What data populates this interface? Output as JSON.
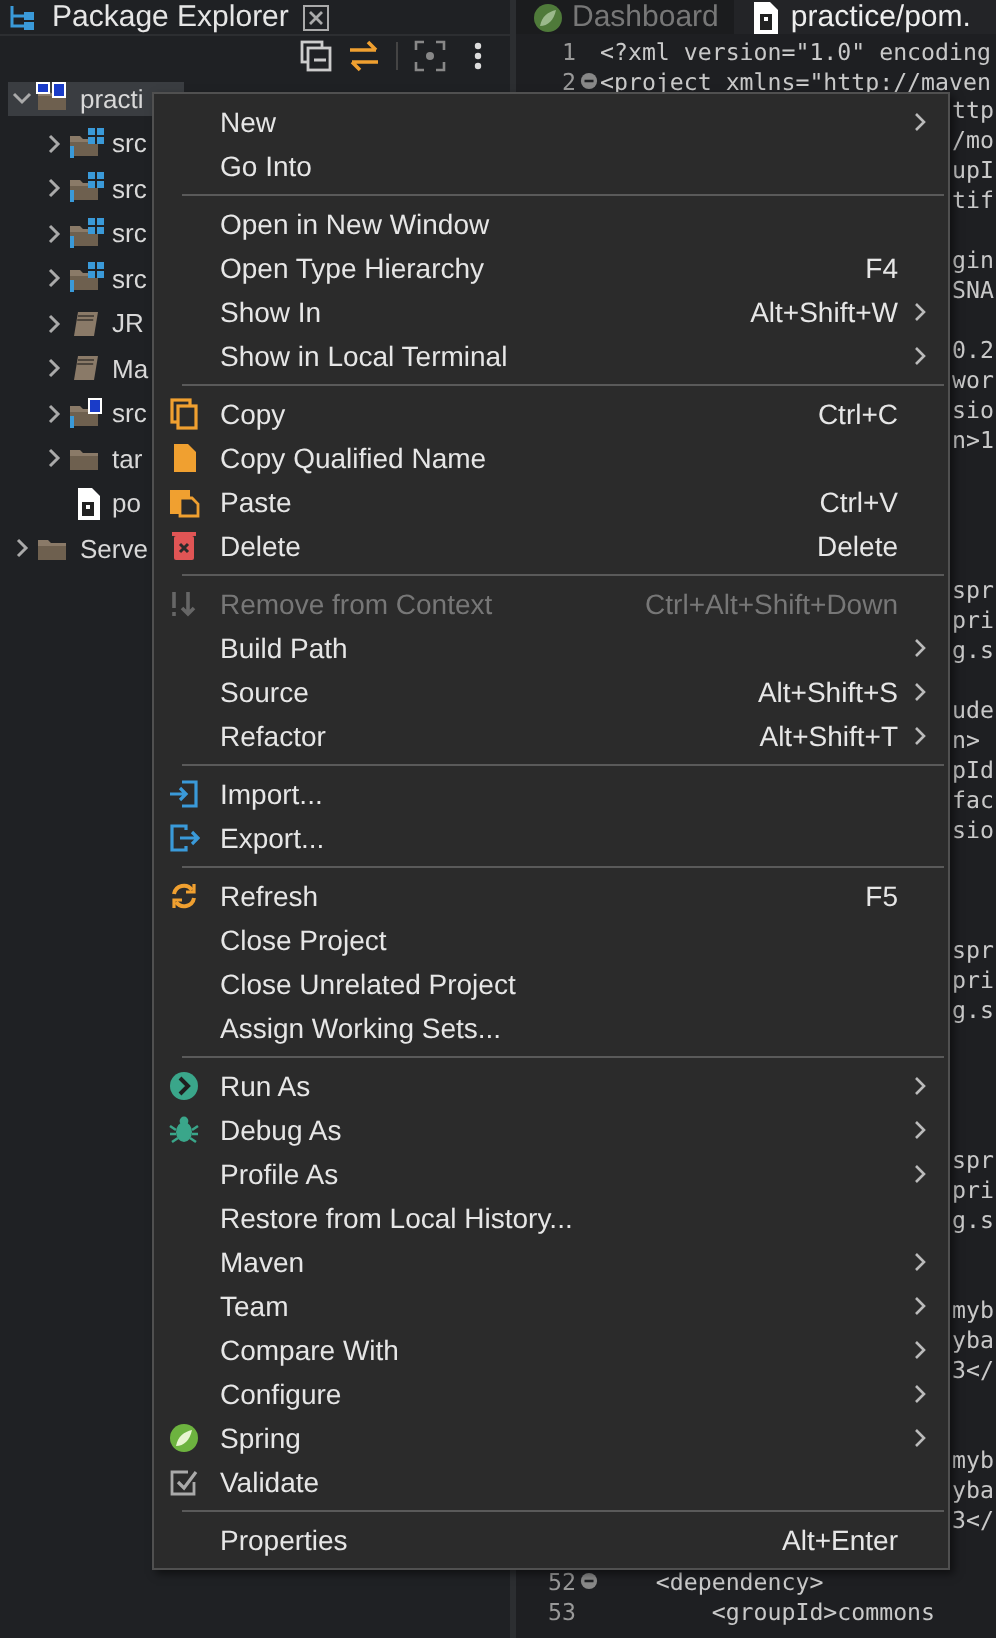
{
  "explorer": {
    "title": "Package Explorer",
    "tree": [
      {
        "label": "practi",
        "kind": "project",
        "selected": true,
        "expanded": true,
        "children": [
          {
            "label": "src",
            "kind": "source-folder",
            "selected": false,
            "expanded": false
          },
          {
            "label": "src",
            "kind": "source-folder",
            "selected": false,
            "expanded": false
          },
          {
            "label": "src",
            "kind": "source-folder",
            "selected": false,
            "expanded": false
          },
          {
            "label": "src",
            "kind": "source-folder",
            "selected": false,
            "expanded": false
          },
          {
            "label": "JR",
            "kind": "library",
            "selected": false,
            "expanded": false
          },
          {
            "label": "Ma",
            "kind": "library",
            "selected": false,
            "expanded": false
          },
          {
            "label": "src",
            "kind": "spring-folder",
            "selected": false,
            "expanded": false
          },
          {
            "label": "tar",
            "kind": "folder",
            "selected": false,
            "expanded": false
          },
          {
            "label": "po",
            "kind": "file",
            "selected": false
          }
        ]
      },
      {
        "label": "Serve",
        "kind": "folder",
        "selected": false,
        "expanded": false
      }
    ]
  },
  "editor": {
    "tabs": [
      {
        "label": "Dashboard",
        "kind": "spring",
        "selected": false
      },
      {
        "label": "practice/pom.",
        "kind": "file",
        "selected": true
      }
    ],
    "lines": [
      {
        "number": "1",
        "code": "<?xml version=\"1.0\" encoding",
        "collapsible": false
      },
      {
        "number": "2",
        "code": "<project xmlns=\"http://maven",
        "collapsible": true
      }
    ],
    "covered_line_ends": [
      "ttp",
      "/mo",
      "upI",
      "tif",
      "gin",
      "SNA",
      "0.2",
      "wor",
      "sio",
      "n>1",
      "spr",
      "pri",
      "g.s",
      "ude",
      "n>",
      "pId",
      "fac",
      "sio",
      "spr",
      "pri",
      "g.s",
      "spr",
      "pri",
      "g.s",
      "myb",
      "yba",
      "3</",
      "myb",
      "yba",
      "3</"
    ],
    "lines_below": [
      {
        "number": "52",
        "code": "    <dependency>",
        "collapsible": true
      },
      {
        "number": "53",
        "code": "        <groupId>commons",
        "collapsible": false
      }
    ]
  },
  "context_menu": {
    "items": [
      {
        "kind": "item",
        "label": "New",
        "submenu": true,
        "disabled": false
      },
      {
        "kind": "item",
        "label": "Go Into",
        "submenu": false,
        "disabled": false
      },
      {
        "kind": "separator"
      },
      {
        "kind": "item",
        "label": "Open in New Window",
        "submenu": false,
        "disabled": false
      },
      {
        "kind": "item",
        "label": "Open Type Hierarchy",
        "shortcut": "F4",
        "submenu": false,
        "disabled": false
      },
      {
        "kind": "item",
        "label": "Show In",
        "shortcut": "Alt+Shift+W",
        "submenu": true,
        "disabled": false
      },
      {
        "kind": "item",
        "label": "Show in Local Terminal",
        "submenu": true,
        "disabled": false
      },
      {
        "kind": "separator"
      },
      {
        "kind": "item",
        "label": "Copy",
        "shortcut": "Ctrl+C",
        "submenu": false,
        "disabled": false
      },
      {
        "kind": "item",
        "label": "Copy Qualified Name",
        "submenu": false,
        "disabled": false
      },
      {
        "kind": "item",
        "label": "Paste",
        "shortcut": "Ctrl+V",
        "submenu": false,
        "disabled": false
      },
      {
        "kind": "item",
        "label": "Delete",
        "shortcut": "Delete",
        "submenu": false,
        "disabled": false
      },
      {
        "kind": "separator"
      },
      {
        "kind": "item",
        "label": "Remove from Context",
        "shortcut": "Ctrl+Alt+Shift+Down",
        "submenu": false,
        "disabled": true
      },
      {
        "kind": "item",
        "label": "Build Path",
        "submenu": true,
        "disabled": false
      },
      {
        "kind": "item",
        "label": "Source",
        "shortcut": "Alt+Shift+S",
        "submenu": true,
        "disabled": false
      },
      {
        "kind": "item",
        "label": "Refactor",
        "shortcut": "Alt+Shift+T",
        "submenu": true,
        "disabled": false
      },
      {
        "kind": "separator"
      },
      {
        "kind": "item",
        "label": "Import...",
        "submenu": false,
        "disabled": false
      },
      {
        "kind": "item",
        "label": "Export...",
        "submenu": false,
        "disabled": false
      },
      {
        "kind": "separator"
      },
      {
        "kind": "item",
        "label": "Refresh",
        "shortcut": "F5",
        "submenu": false,
        "disabled": false
      },
      {
        "kind": "item",
        "label": "Close Project",
        "submenu": false,
        "disabled": false
      },
      {
        "kind": "item",
        "label": "Close Unrelated Project",
        "submenu": false,
        "disabled": false
      },
      {
        "kind": "item",
        "label": "Assign Working Sets...",
        "submenu": false,
        "disabled": false
      },
      {
        "kind": "separator"
      },
      {
        "kind": "item",
        "label": "Run As",
        "submenu": true,
        "disabled": false
      },
      {
        "kind": "item",
        "label": "Debug As",
        "submenu": true,
        "disabled": false
      },
      {
        "kind": "item",
        "label": "Profile As",
        "submenu": true,
        "disabled": false
      },
      {
        "kind": "item",
        "label": "Restore from Local History...",
        "submenu": false,
        "disabled": false
      },
      {
        "kind": "item",
        "label": "Maven",
        "submenu": true,
        "disabled": false
      },
      {
        "kind": "item",
        "label": "Team",
        "submenu": true,
        "disabled": false
      },
      {
        "kind": "item",
        "label": "Compare With",
        "submenu": true,
        "disabled": false
      },
      {
        "kind": "item",
        "label": "Configure",
        "submenu": true,
        "disabled": false
      },
      {
        "kind": "item",
        "label": "Spring",
        "submenu": true,
        "disabled": false
      },
      {
        "kind": "item",
        "label": "Validate",
        "submenu": false,
        "disabled": false
      },
      {
        "kind": "separator"
      },
      {
        "kind": "item",
        "label": "Properties",
        "shortcut": "Alt+Enter",
        "submenu": false,
        "disabled": false
      }
    ]
  }
}
